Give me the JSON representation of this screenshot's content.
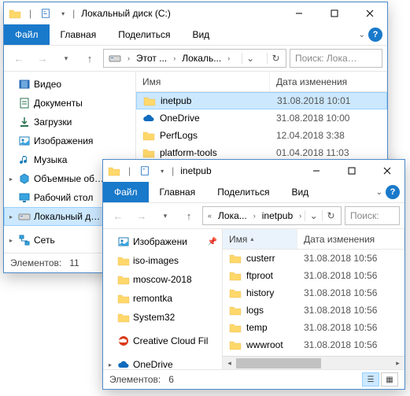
{
  "back_window": {
    "title_prefix": "|",
    "title": "Локальный диск (C:)",
    "tabs": {
      "file": "Файл",
      "home": "Главная",
      "share": "Поделиться",
      "view": "Вид"
    },
    "breadcrumbs": [
      "Этот ...",
      "Локаль..."
    ],
    "search_placeholder": "Поиск: Лока…",
    "columns": {
      "name": "Имя",
      "date": "Дата изменения"
    },
    "name_col_width": 170,
    "tree": [
      {
        "icon": "video",
        "label": "Видео"
      },
      {
        "icon": "document",
        "label": "Документы"
      },
      {
        "icon": "download",
        "label": "Загрузки"
      },
      {
        "icon": "image",
        "label": "Изображения"
      },
      {
        "icon": "music",
        "label": "Музыка"
      },
      {
        "icon": "cube",
        "label": "Объемные об…",
        "caret": true
      },
      {
        "icon": "desktop",
        "label": "Рабочий стол"
      },
      {
        "icon": "drive",
        "label": "Локальный д…",
        "caret": true,
        "active": true
      },
      {
        "spacer": true
      },
      {
        "icon": "network",
        "label": "Сеть",
        "caret": true
      }
    ],
    "rows": [
      {
        "icon": "folder",
        "name": "inetpub",
        "date": "31.08.2018 10:01",
        "selected": true
      },
      {
        "icon": "onedrive",
        "name": "OneDrive",
        "date": "31.08.2018 10:00"
      },
      {
        "icon": "folder",
        "name": "PerfLogs",
        "date": "12.04.2018 3:38"
      },
      {
        "icon": "folder",
        "name": "platform-tools",
        "date": "01.04.2018 11:03"
      }
    ],
    "status": {
      "items_label": "Элементов:",
      "items_count": "11"
    }
  },
  "front_window": {
    "title_prefix": "|",
    "title": "inetpub",
    "tabs": {
      "file": "Файл",
      "home": "Главная",
      "share": "Поделиться",
      "view": "Вид"
    },
    "breadcrumbs": [
      "Лока...",
      "inetpub"
    ],
    "search_placeholder": "Поиск:",
    "columns": {
      "name": "Имя",
      "date": "Дата изменения"
    },
    "name_col_width": 95,
    "tree": [
      {
        "icon": "image",
        "label": "Изображени",
        "pin": true
      },
      {
        "icon": "folder",
        "label": "iso-images"
      },
      {
        "icon": "folder",
        "label": "moscow-2018"
      },
      {
        "icon": "folder",
        "label": "remontka"
      },
      {
        "icon": "folder",
        "label": "System32"
      },
      {
        "spacer": true
      },
      {
        "icon": "cc",
        "label": "Creative Cloud Fil"
      },
      {
        "spacer": true
      },
      {
        "icon": "onedrive",
        "label": "OneDrive",
        "caret": true
      }
    ],
    "rows": [
      {
        "icon": "folder",
        "name": "custerr",
        "date": "31.08.2018 10:56"
      },
      {
        "icon": "folder",
        "name": "ftproot",
        "date": "31.08.2018 10:56"
      },
      {
        "icon": "folder",
        "name": "history",
        "date": "31.08.2018 10:56"
      },
      {
        "icon": "folder",
        "name": "logs",
        "date": "31.08.2018 10:56"
      },
      {
        "icon": "folder",
        "name": "temp",
        "date": "31.08.2018 10:56"
      },
      {
        "icon": "folder",
        "name": "wwwroot",
        "date": "31.08.2018 10:56"
      }
    ],
    "status": {
      "items_label": "Элементов:",
      "items_count": "6"
    }
  }
}
